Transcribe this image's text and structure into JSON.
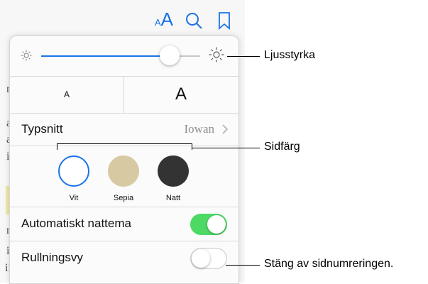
{
  "toolbar": {
    "aa_small": "A",
    "aa_large": "A",
    "accent": "#1a73e8"
  },
  "background_text": {
    "line1": "r",
    "line2": "a",
    "line3": "a",
    "line4": "i",
    "line5": "r",
    "line6": "i",
    "line7": "ii"
  },
  "panel": {
    "brightness": {
      "level_fraction": 0.81,
      "min_icon": "sun-small-icon",
      "max_icon": "sun-large-icon"
    },
    "text_size": {
      "small_label": "A",
      "large_label": "A"
    },
    "font": {
      "label": "Typsnitt",
      "value": "Iowan"
    },
    "page_colors": [
      {
        "label": "Vit",
        "color": "#ffffff",
        "selected": true
      },
      {
        "label": "Sepia",
        "color": "#d7c9a1",
        "selected": false
      },
      {
        "label": "Natt",
        "color": "#333333",
        "selected": false
      }
    ],
    "auto_night": {
      "label": "Automatiskt nattema",
      "on": true,
      "on_color": "#4cd964"
    },
    "scroll_view": {
      "label": "Rullningsvy",
      "on": false
    }
  },
  "callouts": {
    "brightness": "Ljusstyrka",
    "page_color": "Sidfärg",
    "scroll": "Stäng av sidnumreringen."
  }
}
